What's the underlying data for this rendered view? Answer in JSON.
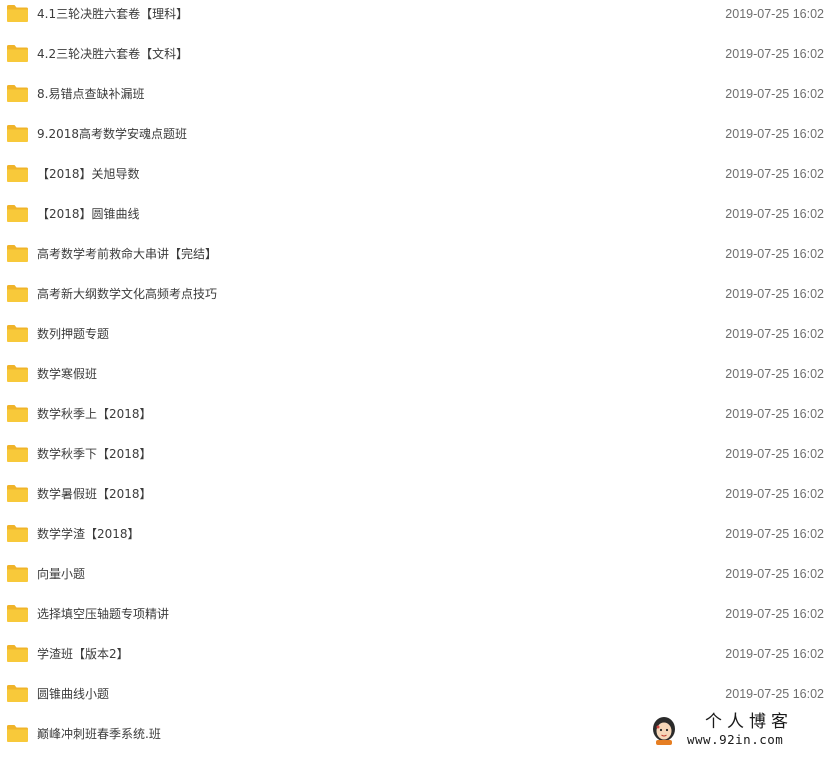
{
  "folders": [
    {
      "name": "4.1三轮决胜六套卷【理科】",
      "modified": "2019-07-25 16:02"
    },
    {
      "name": "4.2三轮决胜六套卷【文科】",
      "modified": "2019-07-25 16:02"
    },
    {
      "name": "8.易错点查缺补漏班",
      "modified": "2019-07-25 16:02"
    },
    {
      "name": "9.2018高考数学安魂点题班",
      "modified": "2019-07-25 16:02"
    },
    {
      "name": "【2018】关旭导数",
      "modified": "2019-07-25 16:02"
    },
    {
      "name": "【2018】圆锥曲线",
      "modified": "2019-07-25 16:02"
    },
    {
      "name": "高考数学考前救命大串讲【完结】",
      "modified": "2019-07-25 16:02"
    },
    {
      "name": "高考新大纲数学文化高频考点技巧",
      "modified": "2019-07-25 16:02"
    },
    {
      "name": "数列押题专题",
      "modified": "2019-07-25 16:02"
    },
    {
      "name": "数学寒假班",
      "modified": "2019-07-25 16:02"
    },
    {
      "name": "数学秋季上【2018】",
      "modified": "2019-07-25 16:02"
    },
    {
      "name": "数学秋季下【2018】",
      "modified": "2019-07-25 16:02"
    },
    {
      "name": "数学暑假班【2018】",
      "modified": "2019-07-25 16:02"
    },
    {
      "name": "数学学渣【2018】",
      "modified": "2019-07-25 16:02"
    },
    {
      "name": "向量小题",
      "modified": "2019-07-25 16:02"
    },
    {
      "name": "选择填空压轴题专项精讲",
      "modified": "2019-07-25 16:02"
    },
    {
      "name": "学渣班【版本2】",
      "modified": "2019-07-25 16:02"
    },
    {
      "name": "圆锥曲线小题",
      "modified": "2019-07-25 16:02"
    },
    {
      "name": "巅峰冲刺班春季系统.班",
      "modified": ""
    }
  ],
  "icon": "folder-icon",
  "colors": {
    "folder": "#f8c93a",
    "folder_dark": "#f0b429",
    "name_text": "#3b3b3b",
    "date_text": "#6e6e6e"
  },
  "watermark": {
    "title": "个人博客",
    "url": "www.92in.com"
  }
}
